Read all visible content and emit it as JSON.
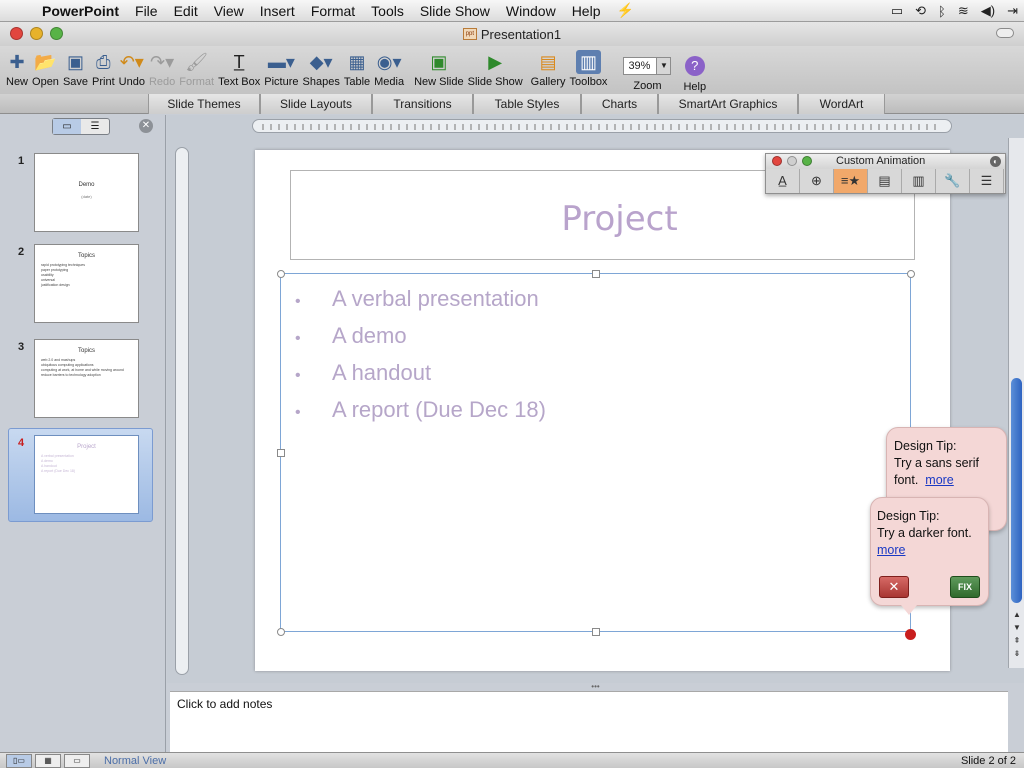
{
  "menubar": {
    "app": "PowerPoint",
    "items": [
      "File",
      "Edit",
      "View",
      "Insert",
      "Format",
      "Tools",
      "Slide Show",
      "Window",
      "Help"
    ],
    "script_icon": "script-icon"
  },
  "window": {
    "title": "Presentation1",
    "doc_badge": "ppt"
  },
  "toolbar": {
    "tools": [
      {
        "label": "New",
        "icon": "new-icon"
      },
      {
        "label": "Open",
        "icon": "open-icon"
      },
      {
        "label": "Save",
        "icon": "save-icon"
      },
      {
        "label": "Print",
        "icon": "print-icon"
      },
      {
        "label": "Undo",
        "icon": "undo-icon"
      },
      {
        "label": "Redo",
        "icon": "redo-icon",
        "disabled": true
      },
      {
        "label": "Format",
        "icon": "format-brush-icon",
        "disabled": true
      },
      {
        "label": "Text Box",
        "icon": "textbox-icon"
      },
      {
        "label": "Picture",
        "icon": "picture-icon"
      },
      {
        "label": "Shapes",
        "icon": "shapes-icon"
      },
      {
        "label": "Table",
        "icon": "table-icon"
      },
      {
        "label": "Media",
        "icon": "media-icon"
      },
      {
        "label": "New Slide",
        "icon": "new-slide-icon"
      },
      {
        "label": "Slide Show",
        "icon": "slide-show-icon"
      },
      {
        "label": "Gallery",
        "icon": "gallery-icon"
      },
      {
        "label": "Toolbox",
        "icon": "toolbox-icon"
      }
    ],
    "zoom_value": "39%",
    "zoom_label": "Zoom",
    "help_label": "Help",
    "help_glyph": "?"
  },
  "gallery_tabs": [
    "Slide Themes",
    "Slide Layouts",
    "Transitions",
    "Table Styles",
    "Charts",
    "SmartArt Graphics",
    "WordArt"
  ],
  "slides": [
    {
      "number": "1",
      "title": "Demo",
      "subtitle": "(date)"
    },
    {
      "number": "2",
      "title": "Topics",
      "bullets": [
        "rapid prototyping techniques",
        "paper prototyping",
        "usability",
        "universal",
        "justification design"
      ]
    },
    {
      "number": "3",
      "title": "Topics",
      "bullets": [
        "web 2.0 and mashups",
        "ubiquitous computing applications",
        "computing at work, at home and while moving around",
        "reduce barriers to technology adoption"
      ]
    },
    {
      "number": "4",
      "title": "Project",
      "bullets": [
        "A verbal presentation",
        "A demo",
        "A handout",
        "A report (Due Dec 18)"
      ]
    }
  ],
  "slide": {
    "title": "Project",
    "bullet_glyph": "•",
    "bullets": [
      "A verbal presentation",
      "A demo",
      "A handout",
      "A report (Due Dec 18)"
    ]
  },
  "custom_animation": {
    "title": "Custom Animation"
  },
  "tips": [
    {
      "heading": "Design Tip:",
      "text": "Try a sans serif font.",
      "link": "more"
    },
    {
      "heading": "Design Tip:",
      "text": "Try a darker font.",
      "link": "more",
      "dismiss": "✕",
      "fix": "FIX"
    }
  ],
  "notes": {
    "placeholder": "Click to add notes"
  },
  "status": {
    "view_name": "Normal View",
    "slide_counter": "Slide 2 of 2"
  },
  "colors": {
    "title_text": "#b9a3cc",
    "body_text": "#b6a6c9",
    "accent_blue": "#2e63c1"
  }
}
